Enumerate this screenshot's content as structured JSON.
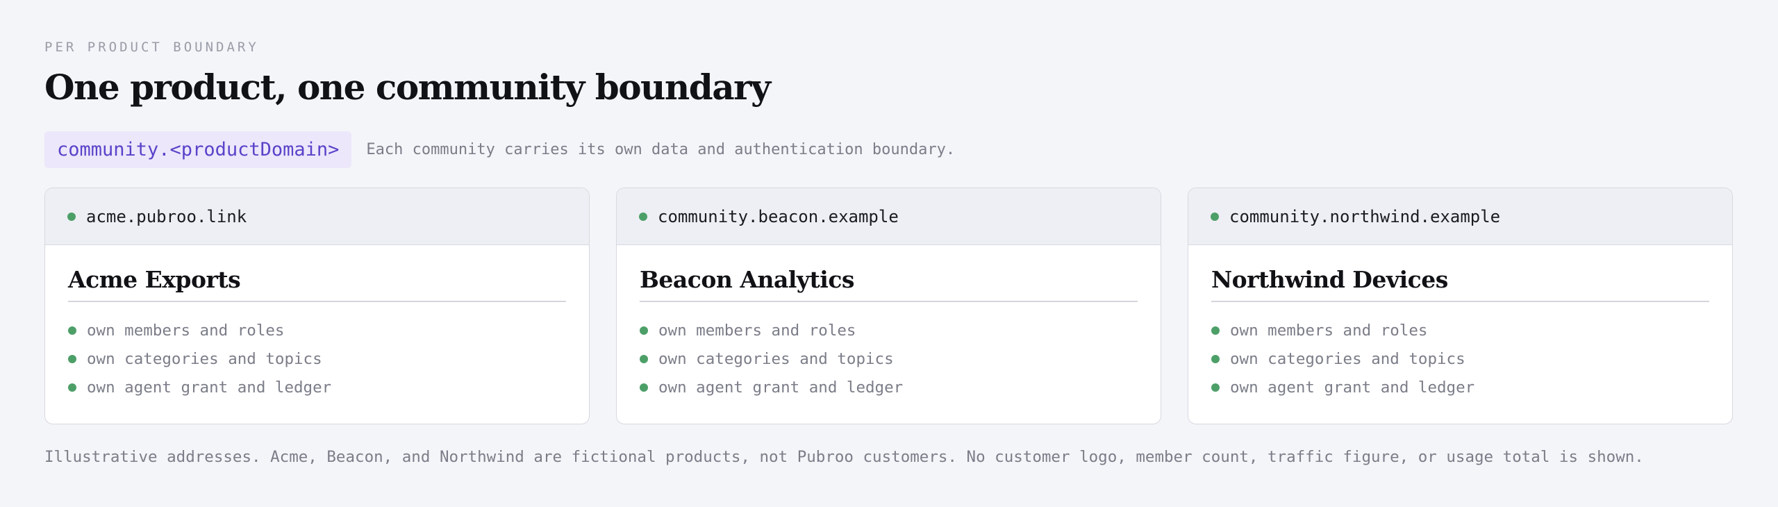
{
  "header": {
    "eyebrow": "PER PRODUCT BOUNDARY",
    "title": "One product, one community boundary"
  },
  "pattern": {
    "code": "community.<productDomain>",
    "description": "Each community carries its own data and authentication boundary."
  },
  "cards": [
    {
      "domain": "acme.pubroo.link",
      "name": "Acme Exports",
      "features": [
        "own members and roles",
        "own categories and topics",
        "own agent grant and ledger"
      ]
    },
    {
      "domain": "community.beacon.example",
      "name": "Beacon Analytics",
      "features": [
        "own members and roles",
        "own categories and topics",
        "own agent grant and ledger"
      ]
    },
    {
      "domain": "community.northwind.example",
      "name": "Northwind Devices",
      "features": [
        "own members and roles",
        "own categories and topics",
        "own agent grant and ledger"
      ]
    }
  ],
  "footnote": "Illustrative addresses. Acme, Beacon, and Northwind are fictional products, not Pubroo customers. No customer logo, member count, traffic figure, or usage total is shown.",
  "colors": {
    "accent": "#5a43c9",
    "accent_bg": "#ece7fb",
    "status_dot": "#4d9f68",
    "background": "#f4f5f9"
  },
  "icons": {
    "status": "green-dot-icon",
    "bullet": "green-bullet-icon"
  }
}
